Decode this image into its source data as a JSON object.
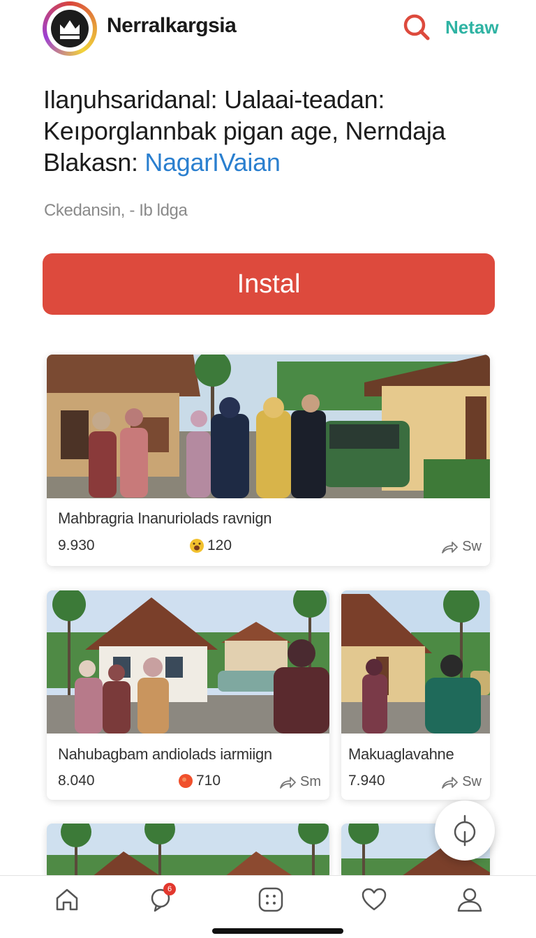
{
  "header": {
    "app_name": "Nerralkargsia",
    "search_icon": "search-icon",
    "action_label": "Netaw"
  },
  "article": {
    "headline": "Ilaŋuhsaridanal: Ualaai-teadan: Keıporglannbak pigan age, Nerndaja Blakasn: ",
    "headline_link": "NagarIVaian",
    "meta": "Ckedansin, - Ib ldga"
  },
  "install_button": {
    "label": "Instal"
  },
  "cards": [
    {
      "title": "Mahbragria Inanuriolads ravnign",
      "count": "9.930",
      "reaction_icon": "laugh-emoji-icon",
      "reactions": "120",
      "share_label": "Sw"
    },
    {
      "title": "Nahubagbam andiolads iarmiign",
      "count": "8.040",
      "reaction_icon": "heart-emoji-icon",
      "reactions": "710",
      "share_label": "Sm"
    },
    {
      "title": "Makuaglavahne",
      "count": "7.940",
      "reaction_icon": "",
      "reactions": "",
      "share_label": "Sw"
    }
  ],
  "bottom_nav": {
    "items": [
      {
        "icon": "home-icon"
      },
      {
        "icon": "chat-icon",
        "badge": "6"
      },
      {
        "icon": "apps-icon"
      },
      {
        "icon": "heart-icon"
      },
      {
        "icon": "profile-icon"
      }
    ]
  },
  "colors": {
    "accent_red": "#dd4a3d",
    "accent_teal": "#2fb3a3",
    "link_blue": "#2a7fcf"
  }
}
